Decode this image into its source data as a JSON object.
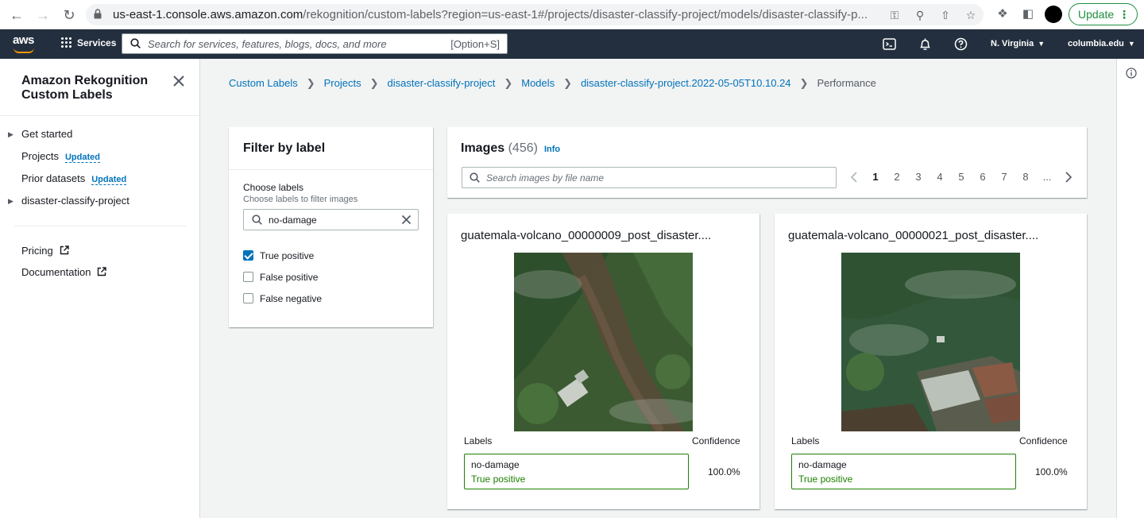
{
  "browser": {
    "url_host": "us-east-1.console.aws.amazon.com",
    "url_path": "/rekognition/custom-labels?region=us-east-1#/projects/disaster-classify-project/models/disaster-classify-p...",
    "update_label": "Update"
  },
  "aws_nav": {
    "logo_text": "aws",
    "services_label": "Services",
    "search_placeholder": "Search for services, features, blogs, docs, and more",
    "search_shortcut": "[Option+S]",
    "region": "N. Virginia",
    "account": "columbia.edu"
  },
  "sidebar": {
    "title": "Amazon Rekognition Custom Labels",
    "items": [
      {
        "label": "Get started",
        "expandable": true
      },
      {
        "label": "Projects",
        "badge": "Updated"
      },
      {
        "label": "Prior datasets",
        "badge": "Updated"
      },
      {
        "label": "disaster-classify-project",
        "expandable": true
      }
    ],
    "links": [
      {
        "label": "Pricing"
      },
      {
        "label": "Documentation"
      }
    ]
  },
  "breadcrumb": [
    "Custom Labels",
    "Projects",
    "disaster-classify-project",
    "Models",
    "disaster-classify-project.2022-05-05T10.10.24",
    "Performance"
  ],
  "filter": {
    "title": "Filter by label",
    "choose_label": "Choose labels",
    "choose_desc": "Choose labels to filter images",
    "input_value": "no-damage",
    "options": [
      {
        "label": "True positive",
        "checked": true
      },
      {
        "label": "False positive",
        "checked": false
      },
      {
        "label": "False negative",
        "checked": false
      }
    ]
  },
  "images": {
    "title": "Images",
    "count": "(456)",
    "info": "Info",
    "search_placeholder": "Search images by file name",
    "pages": [
      "1",
      "2",
      "3",
      "4",
      "5",
      "6",
      "7",
      "8",
      "..."
    ],
    "current_page": "1"
  },
  "cards": [
    {
      "file_name": "guatemala-volcano_00000009_post_disaster....",
      "labels_header": "Labels",
      "confidence_header": "Confidence",
      "label": "no-damage",
      "status": "True positive",
      "confidence": "100.0%"
    },
    {
      "file_name": "guatemala-volcano_00000021_post_disaster....",
      "labels_header": "Labels",
      "confidence_header": "Confidence",
      "label": "no-damage",
      "status": "True positive",
      "confidence": "100.0%"
    }
  ],
  "colors": {
    "aws_nav_bg": "#232f3e",
    "link": "#0073bb",
    "success": "#1d8102",
    "aws_orange": "#ff9900"
  }
}
